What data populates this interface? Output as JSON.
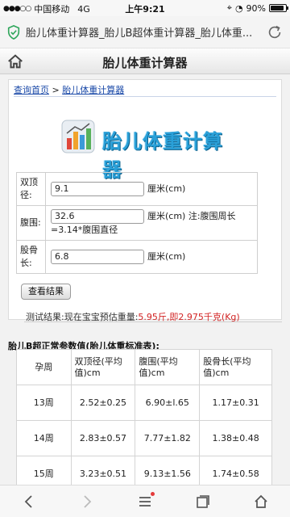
{
  "status_bar": {
    "carrier": "中国移动",
    "network": "4G",
    "time": "上午9:21",
    "battery_percent": "90%",
    "battery_level": 0.9
  },
  "browser": {
    "url_title": "胎儿体重计算器_胎儿B超体重计算器_胎儿体重...",
    "accent": "#2fa65b"
  },
  "site": {
    "header_title": "胎儿体重计算器",
    "breadcrumb_home": "查询首页",
    "breadcrumb_sep": " > ",
    "breadcrumb_current": "胎儿体重计算器",
    "logo_text": "胎儿体重计算器"
  },
  "form": {
    "bpd_label": "双顶径:",
    "bpd_value": "9.1",
    "bpd_unit": "厘米(cm)",
    "ac_label": "腹围:",
    "ac_value": "32.6",
    "ac_unit": "厘米(cm) 注:腹围周长=3.14*腹围直径",
    "fl_label": "股骨长:",
    "fl_value": "6.8",
    "fl_unit": "厘米(cm)",
    "submit_label": "查看结果"
  },
  "result": {
    "prefix": "测试结果:现在宝宝预估重量:",
    "value": "5.95斤,即2.975千克(Kg)",
    "value_color": "#d22323"
  },
  "standard_table": {
    "title": "胎儿B超正常参数值(胎儿体重标准表):",
    "headers": [
      "孕周",
      "双顶径(平均值)cm",
      "腹围(平均值)cm",
      "股骨长(平均值)cm"
    ],
    "rows": [
      [
        "13周",
        "2.52±0.25",
        "6.90±l.65",
        "1.17±0.31"
      ],
      [
        "14周",
        "2.83±0.57",
        "7.77±1.82",
        "1.38±0.48"
      ],
      [
        "15周",
        "3.23±0.51",
        "9.13±1.56",
        "1.74±0.58"
      ]
    ]
  },
  "bottom_nav": {
    "items": [
      "back-icon",
      "forward-icon",
      "menu-icon",
      "tabs-icon",
      "home-icon"
    ]
  }
}
